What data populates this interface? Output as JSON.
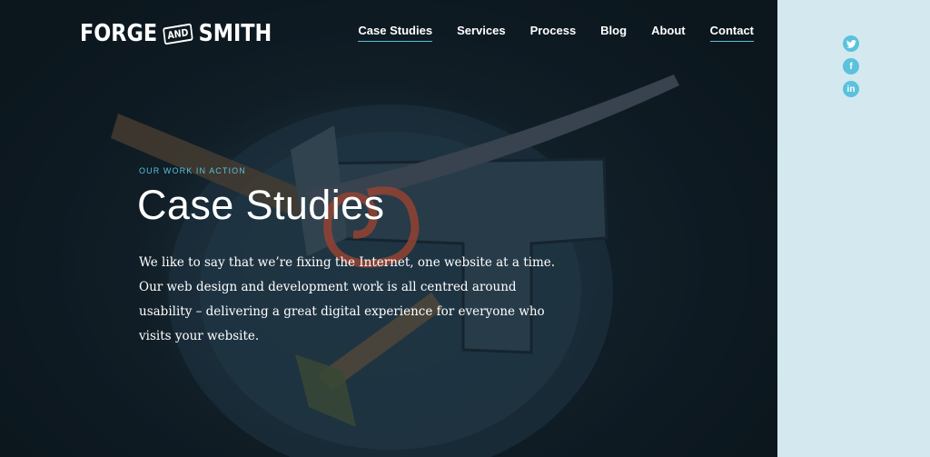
{
  "brand": {
    "name_left": "FORGE",
    "name_mid": "AND",
    "name_right": "SMITH"
  },
  "nav": {
    "items": [
      {
        "label": "Case Studies",
        "underlined": true
      },
      {
        "label": "Services"
      },
      {
        "label": "Process"
      },
      {
        "label": "Blog"
      },
      {
        "label": "About"
      },
      {
        "label": "Contact",
        "underlined": true
      }
    ]
  },
  "hero": {
    "eyebrow": "OUR WORK IN ACTION",
    "title": "Case Studies",
    "intro": "We like to say that we’re fixing the Internet, one website at a time. Our web design and development work is all centred around usability – delivering a great digital experience for everyone who visits your website.",
    "image_subject": "blacksmith-anvil-tools"
  },
  "social": {
    "items": [
      {
        "icon": "twitter-icon"
      },
      {
        "icon": "facebook-icon",
        "glyph": "f"
      },
      {
        "icon": "linkedin-icon",
        "glyph": "in"
      }
    ]
  },
  "colors": {
    "accent": "#5bc0d8",
    "sidebar": "#d4e9ef",
    "hero_dark": "#122029"
  }
}
